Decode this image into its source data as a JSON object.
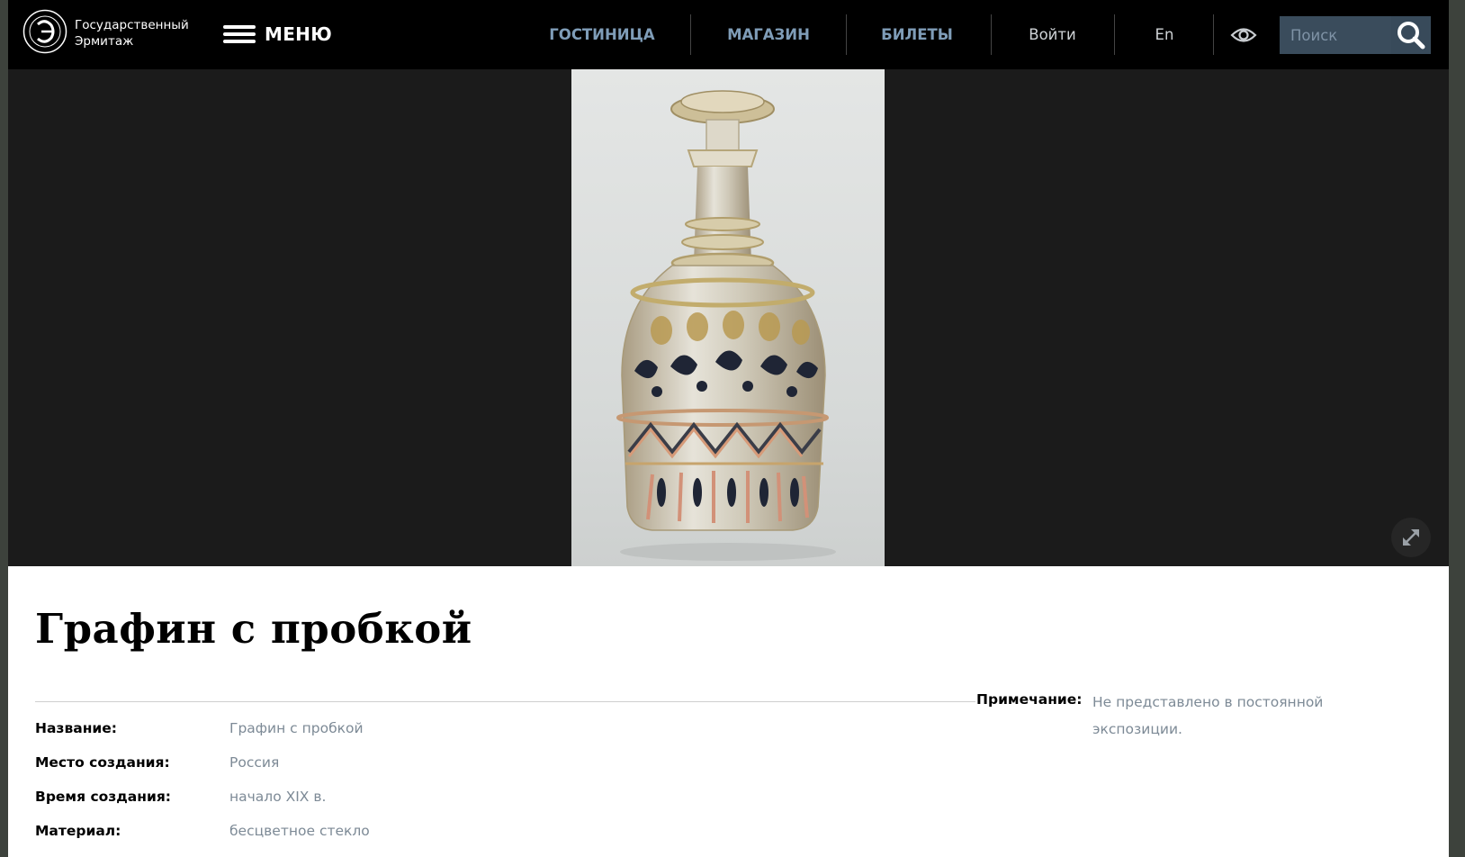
{
  "header": {
    "logo_text_line1": "Государственный",
    "logo_text_line2": "Эрмитаж",
    "menu_label": "МЕНЮ",
    "nav": {
      "hotel": "ГОСТИНИЦА",
      "shop": "МАГАЗИН",
      "tickets": "БИЛЕТЫ",
      "login": "Войти",
      "language": "En"
    },
    "search_placeholder": "Поиск",
    "accent_color": "#7f9db8"
  },
  "hero": {
    "image_subject": "glass decanter with stopper"
  },
  "object": {
    "title": "Графин с пробкой",
    "fields": [
      {
        "label": "Название:",
        "value": "Графин с пробкой"
      },
      {
        "label": "Место создания:",
        "value": "Россия"
      },
      {
        "label": "Время создания:",
        "value": "начало XIX в."
      },
      {
        "label": "Материал:",
        "value": "бесцветное стекло"
      }
    ],
    "note_label": "Примечание:",
    "note_value": "Не представлено в постоянной экспозиции."
  }
}
